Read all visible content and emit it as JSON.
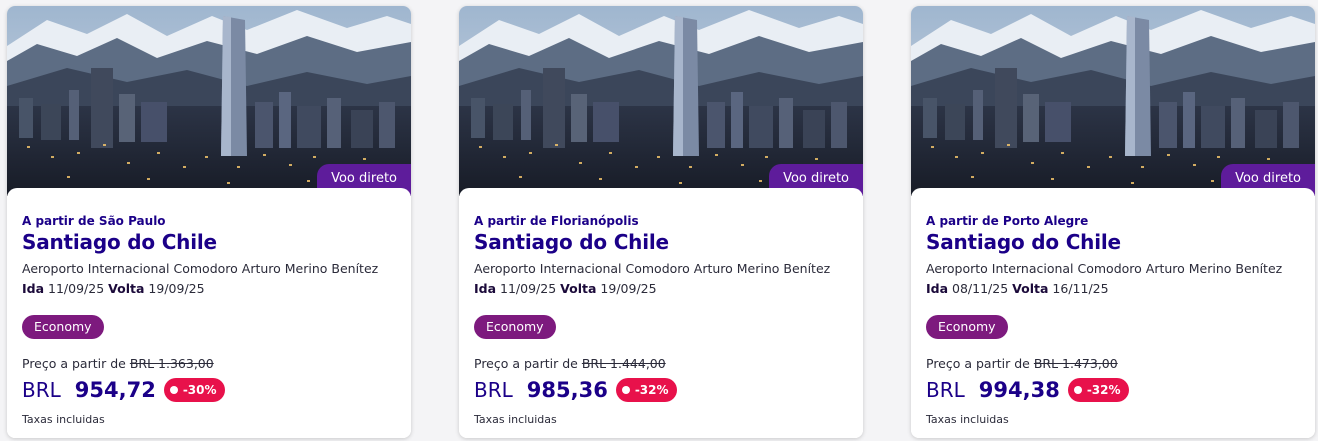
{
  "cards": [
    {
      "badge": "Voo direto",
      "from": "A partir de São Paulo",
      "destination": "Santiago do Chile",
      "airport": "Aeroporto Internacional Comodoro Arturo Merino Benítez",
      "ida_label": "Ida",
      "ida_date": "11/09/25",
      "volta_label": "Volta",
      "volta_date": "19/09/25",
      "cabin": "Economy",
      "price_from_label": "Preço a partir de",
      "old_price": "BRL 1.363,00",
      "currency": "BRL",
      "price": "954,72",
      "discount": "-30%",
      "taxes": "Taxas incluidas"
    },
    {
      "badge": "Voo direto",
      "from": "A partir de Florianópolis",
      "destination": "Santiago do Chile",
      "airport": "Aeroporto Internacional Comodoro Arturo Merino Benítez",
      "ida_label": "Ida",
      "ida_date": "11/09/25",
      "volta_label": "Volta",
      "volta_date": "19/09/25",
      "cabin": "Economy",
      "price_from_label": "Preço a partir de",
      "old_price": "BRL 1.444,00",
      "currency": "BRL",
      "price": "985,36",
      "discount": "-32%",
      "taxes": "Taxas incluidas"
    },
    {
      "badge": "Voo direto",
      "from": "A partir de Porto Alegre",
      "destination": "Santiago do Chile",
      "airport": "Aeroporto Internacional Comodoro Arturo Merino Benítez",
      "ida_label": "Ida",
      "ida_date": "08/11/25",
      "volta_label": "Volta",
      "volta_date": "16/11/25",
      "cabin": "Economy",
      "price_from_label": "Preço a partir de",
      "old_price": "BRL 1.473,00",
      "currency": "BRL",
      "price": "994,38",
      "discount": "-32%",
      "taxes": "Taxas incluidas"
    }
  ],
  "colors": {
    "brand_navy": "#1b0088",
    "badge_purple": "#5e1c9b",
    "cabin_purple": "#7d1a7e",
    "discount_red": "#e8114b"
  }
}
